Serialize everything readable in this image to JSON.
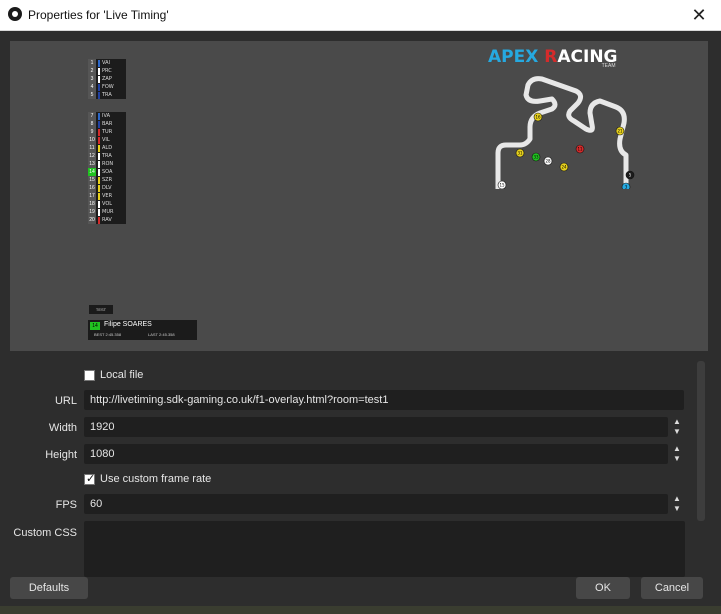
{
  "window": {
    "title": "Properties for 'Live Timing'",
    "close_glyph": "✕"
  },
  "preview": {
    "logo": {
      "name_part1": "APEX ",
      "name_part2": "R",
      "name_part3": "ACING",
      "sub": "TEAM"
    },
    "tower_top": [
      {
        "pos": "1",
        "code": "VAI",
        "color": "#2b67c9"
      },
      {
        "pos": "2",
        "code": "PRC",
        "color": "#ffffff"
      },
      {
        "pos": "3",
        "code": "ZAP",
        "color": "#ffffff"
      },
      {
        "pos": "4",
        "code": "FOW",
        "color": "#2040a0"
      },
      {
        "pos": "5",
        "code": "TRA",
        "color": "#2040a0"
      }
    ],
    "tower_bottom": [
      {
        "pos": "7",
        "code": "IVA",
        "color": "#2b67c9"
      },
      {
        "pos": "8",
        "code": "BAR",
        "color": "#2040a0"
      },
      {
        "pos": "9",
        "code": "TUR",
        "color": "#d42b2b"
      },
      {
        "pos": "10",
        "code": "VIL",
        "color": "#d42b2b"
      },
      {
        "pos": "11",
        "code": "ALD",
        "color": "#e8d21d"
      },
      {
        "pos": "12",
        "code": "TRA",
        "color": "#ffffff"
      },
      {
        "pos": "13",
        "code": "RON",
        "color": "#ffffff"
      },
      {
        "pos": "14",
        "code": "SOA",
        "color": "#ffffff"
      },
      {
        "pos": "15",
        "code": "SZR",
        "color": "#e8d21d"
      },
      {
        "pos": "16",
        "code": "DLV",
        "color": "#e8d21d"
      },
      {
        "pos": "17",
        "code": "VER",
        "color": "#e8d21d"
      },
      {
        "pos": "18",
        "code": "VOL",
        "color": "#ffffff"
      },
      {
        "pos": "19",
        "code": "MUR",
        "color": "#ffffff"
      },
      {
        "pos": "20",
        "code": "RAV",
        "color": "#d42b2b"
      }
    ],
    "small_tag": "TEST",
    "driver_card": {
      "number": "14",
      "name": "Filipe SOARES",
      "best": "BEST  2:45.358",
      "last": "LAST  2:45.358"
    },
    "track_markers": [
      "16",
      "21",
      "31",
      "33",
      "11",
      "28",
      "24",
      "5",
      "3",
      "15",
      "32",
      "20",
      "30",
      "19"
    ]
  },
  "form": {
    "local_file_label": "Local file",
    "local_file_checked": false,
    "url_label": "URL",
    "url_value": "http://livetiming.sdk-gaming.co.uk/f1-overlay.html?room=test1",
    "width_label": "Width",
    "width_value": "1920",
    "height_label": "Height",
    "height_value": "1080",
    "custom_rate_label": "Use custom frame rate",
    "custom_rate_checked": true,
    "fps_label": "FPS",
    "fps_value": "60",
    "css_label": "Custom CSS",
    "css_value": ""
  },
  "buttons": {
    "defaults": "Defaults",
    "ok": "OK",
    "cancel": "Cancel"
  }
}
